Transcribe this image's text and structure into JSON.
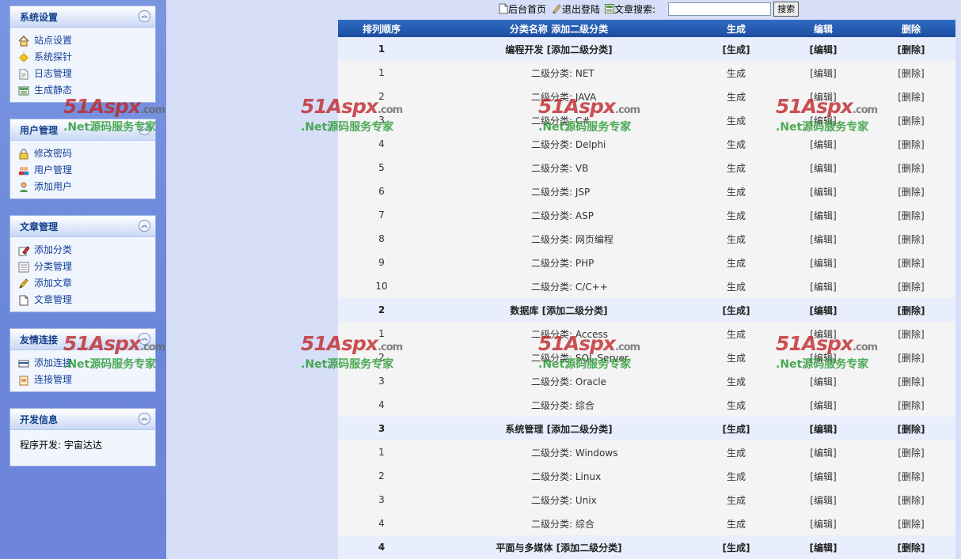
{
  "sidebar": {
    "panels": [
      {
        "title": "系统设置",
        "items": [
          {
            "label": "站点设置",
            "icon": "home-icon"
          },
          {
            "label": "系统探针",
            "icon": "sun-icon"
          },
          {
            "label": "日志管理",
            "icon": "log-icon"
          },
          {
            "label": "生成静态",
            "icon": "static-icon"
          }
        ]
      },
      {
        "title": "用户管理",
        "items": [
          {
            "label": "修改密码",
            "icon": "lock-icon"
          },
          {
            "label": "用户管理",
            "icon": "users-icon"
          },
          {
            "label": "添加用户",
            "icon": "user-add-icon"
          }
        ]
      },
      {
        "title": "文章管理",
        "items": [
          {
            "label": "添加分类",
            "icon": "edit-icon"
          },
          {
            "label": "分类管理",
            "icon": "list-icon"
          },
          {
            "label": "添加文章",
            "icon": "pencil-icon"
          },
          {
            "label": "文章管理",
            "icon": "document-icon"
          }
        ]
      },
      {
        "title": "友情连接",
        "items": [
          {
            "label": "添加连接",
            "icon": "card-icon"
          },
          {
            "label": "连接管理",
            "icon": "link-manage-icon"
          }
        ]
      },
      {
        "title": "开发信息",
        "text": "程序开发: 宇宙达达"
      }
    ]
  },
  "topbar": {
    "home_label": "后台首页",
    "logout_label": "退出登陆",
    "search_label": "文章搜索:",
    "search_value": "",
    "search_button": "搜索"
  },
  "table": {
    "headers": [
      "排列顺序",
      "分类名称 添加二级分类",
      "生成",
      "编辑",
      "删除"
    ],
    "subprefix": "二级分类:",
    "actions": {
      "gen": "生成",
      "edit": "编辑",
      "del": "删除"
    },
    "categories": [
      {
        "order": "1",
        "name": "编程开发",
        "add_label": "[添加二级分类]",
        "subs": [
          {
            "order": "1",
            "name": "NET"
          },
          {
            "order": "2",
            "name": "JAVA"
          },
          {
            "order": "3",
            "name": "C#"
          },
          {
            "order": "4",
            "name": "Delphi"
          },
          {
            "order": "5",
            "name": "VB"
          },
          {
            "order": "6",
            "name": "JSP"
          },
          {
            "order": "7",
            "name": "ASP"
          },
          {
            "order": "8",
            "name": "网页编程"
          },
          {
            "order": "9",
            "name": "PHP"
          },
          {
            "order": "10",
            "name": "C/C++"
          }
        ]
      },
      {
        "order": "2",
        "name": "数据库",
        "add_label": "[添加二级分类]",
        "subs": [
          {
            "order": "1",
            "name": "Access"
          },
          {
            "order": "2",
            "name": "SQL Server"
          },
          {
            "order": "3",
            "name": "Oracle"
          },
          {
            "order": "4",
            "name": "综合"
          }
        ]
      },
      {
        "order": "3",
        "name": "系统管理",
        "add_label": "[添加二级分类]",
        "subs": [
          {
            "order": "1",
            "name": "Windows"
          },
          {
            "order": "2",
            "name": "Linux"
          },
          {
            "order": "3",
            "name": "Unix"
          },
          {
            "order": "4",
            "name": "综合"
          }
        ]
      },
      {
        "order": "4",
        "name": "平面与多媒体",
        "add_label": "[添加二级分类]",
        "subs": []
      }
    ]
  },
  "watermark": {
    "logo": "51Aspx",
    "suffix": ".com",
    "tagline": ".Net源码服务专家"
  },
  "colors": {
    "sidebar": "#6f84dc",
    "header": "#1c4d9e",
    "accent_text": "#14409a"
  }
}
